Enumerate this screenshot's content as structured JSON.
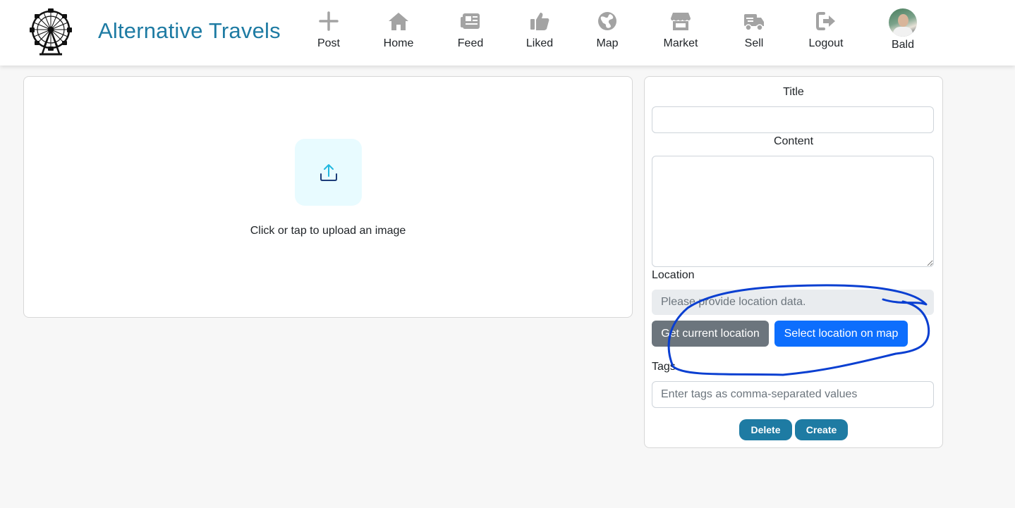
{
  "header": {
    "brand": "Alternative Travels",
    "nav": [
      {
        "id": "post",
        "label": "Post",
        "icon": "plus-icon"
      },
      {
        "id": "home",
        "label": "Home",
        "icon": "home-icon"
      },
      {
        "id": "feed",
        "label": "Feed",
        "icon": "newspaper-icon"
      },
      {
        "id": "liked",
        "label": "Liked",
        "icon": "thumbs-up-icon"
      },
      {
        "id": "map",
        "label": "Map",
        "icon": "globe-icon"
      },
      {
        "id": "market",
        "label": "Market",
        "icon": "store-icon"
      },
      {
        "id": "sell",
        "label": "Sell",
        "icon": "truck-icon"
      },
      {
        "id": "logout",
        "label": "Logout",
        "icon": "sign-out-icon"
      },
      {
        "id": "profile",
        "label": "Bald",
        "icon": "avatar"
      }
    ]
  },
  "upload": {
    "text": "Click or tap to upload an image",
    "icon": "upload-icon"
  },
  "form": {
    "title_label": "Title",
    "title_value": "",
    "content_label": "Content",
    "content_value": "",
    "location_label": "Location",
    "location_placeholder": "Please provide location data.",
    "get_location_button": "Get current location",
    "select_location_button": "Select location on map",
    "tags_label": "Tags",
    "tags_placeholder": "Enter tags as comma-separated values",
    "delete_button": "Delete",
    "create_button": "Create"
  },
  "colors": {
    "brand": "#1e7ba3",
    "primary": "#0d6efd",
    "secondary": "#6c757d",
    "nav_icon": "#a3a3a3",
    "annotation": "#0a3fd1"
  }
}
